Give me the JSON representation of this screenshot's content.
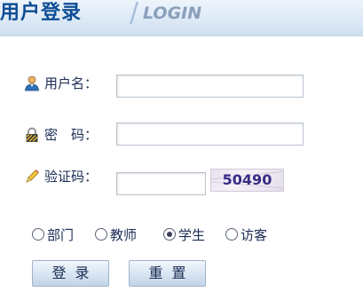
{
  "header": {
    "title_cn": "用户登录",
    "separator": "/",
    "title_en": "LOGIN"
  },
  "form": {
    "username": {
      "icon": "user-icon",
      "label": "用户名：",
      "value": ""
    },
    "password": {
      "icon": "lock-icon",
      "label": "密　码：",
      "value": ""
    },
    "captcha": {
      "icon": "pencil-icon",
      "label": "验证码：",
      "value": "",
      "code": "50490"
    },
    "roles": [
      {
        "label": "部门",
        "checked": false
      },
      {
        "label": "教师",
        "checked": false
      },
      {
        "label": "学生",
        "checked": true
      },
      {
        "label": "访客",
        "checked": false
      }
    ],
    "buttons": {
      "login": "登录",
      "reset": "重置"
    }
  },
  "colors": {
    "title": "#0d4d94",
    "header_bg": "#dde9f6",
    "text": "#1b2c54"
  }
}
